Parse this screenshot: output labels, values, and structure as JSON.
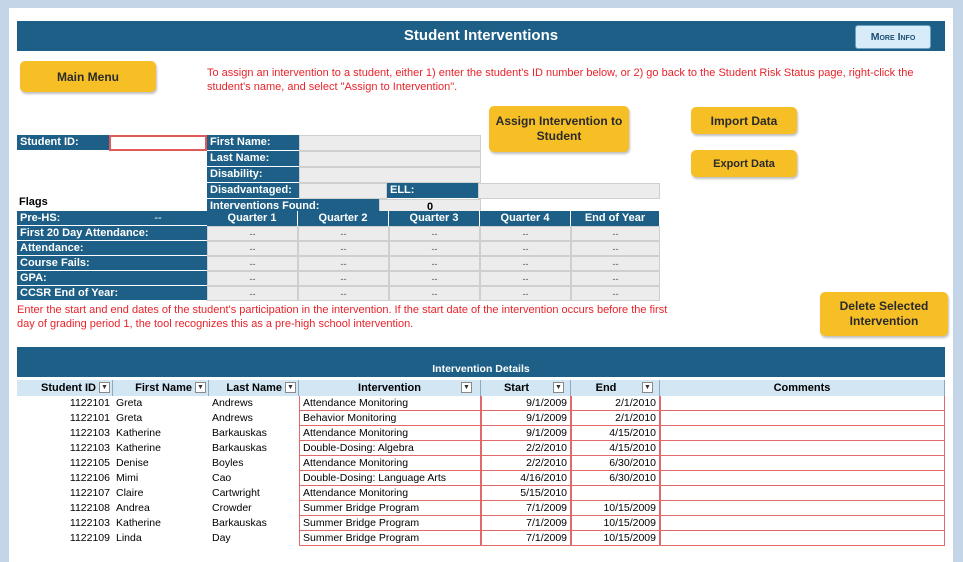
{
  "title": "Student Interventions",
  "more_info_label": "More Info",
  "main_menu_label": "Main Menu",
  "instructions": "To assign an intervention to a student, either 1) enter the student's ID number below, or 2) go back to the Student Risk Status page, right-click the student's name, and select \"Assign to Intervention\".",
  "student_form": {
    "student_id_label": "Student ID:",
    "student_id_value": "",
    "first_name_label": "First Name:",
    "last_name_label": "Last Name:",
    "disability_label": "Disability:",
    "disadvantaged_label": "Disadvantaged:",
    "ell_label": "ELL:",
    "interventions_found_label": "Interventions Found:",
    "interventions_found_value": "0"
  },
  "assign_button_label": "Assign Intervention to Student",
  "import_button_label": "Import Data",
  "export_button_label": "Export Data",
  "delete_button_label": "Delete Selected Intervention",
  "flags": {
    "section_label": "Flags",
    "prehs_label": "Pre-HS:",
    "prehs_value": "--",
    "columns": [
      "Quarter 1",
      "Quarter 2",
      "Quarter 3",
      "Quarter 4",
      "End of Year"
    ],
    "rows": [
      {
        "label": "First 20 Day Attendance:",
        "values": [
          "--",
          "--",
          "--",
          "--",
          "--"
        ]
      },
      {
        "label": "Attendance:",
        "values": [
          "--",
          "--",
          "--",
          "--",
          "--"
        ]
      },
      {
        "label": "Course Fails:",
        "values": [
          "--",
          "--",
          "--",
          "--",
          "--"
        ]
      },
      {
        "label": "GPA:",
        "values": [
          "--",
          "--",
          "--",
          "--",
          "--"
        ]
      },
      {
        "label": "CCSR End of Year:",
        "values": [
          "--",
          "--",
          "--",
          "--",
          "--"
        ]
      }
    ]
  },
  "date_instructions": "Enter the start and end dates of the student's participation in the intervention. If the start date of the intervention occurs before the first day of grading period 1, the tool recognizes this as a pre-high school intervention.",
  "details": {
    "title": "Intervention Details",
    "columns": [
      "Student ID",
      "First Name",
      "Last Name",
      "Intervention",
      "Start",
      "End",
      "Comments"
    ],
    "rows": [
      [
        "1122101",
        "Greta",
        "Andrews",
        "Attendance Monitoring",
        "9/1/2009",
        "2/1/2010",
        ""
      ],
      [
        "1122101",
        "Greta",
        "Andrews",
        "Behavior Monitoring",
        "9/1/2009",
        "2/1/2010",
        ""
      ],
      [
        "1122103",
        "Katherine",
        "Barkauskas",
        "Attendance Monitoring",
        "9/1/2009",
        "4/15/2010",
        ""
      ],
      [
        "1122103",
        "Katherine",
        "Barkauskas",
        "Double-Dosing: Algebra",
        "2/2/2010",
        "4/15/2010",
        ""
      ],
      [
        "1122105",
        "Denise",
        "Boyles",
        "Attendance Monitoring",
        "2/2/2010",
        "6/30/2010",
        ""
      ],
      [
        "1122106",
        "Mimi",
        "Cao",
        "Double-Dosing: Language Arts",
        "4/16/2010",
        "6/30/2010",
        ""
      ],
      [
        "1122107",
        "Claire",
        "Cartwright",
        "Attendance Monitoring",
        "5/15/2010",
        "",
        ""
      ],
      [
        "1122108",
        "Andrea",
        "Crowder",
        "Summer Bridge Program",
        "7/1/2009",
        "10/15/2009",
        ""
      ],
      [
        "1122103",
        "Katherine",
        "Barkauskas",
        "Summer Bridge Program",
        "7/1/2009",
        "10/15/2009",
        ""
      ],
      [
        "1122109",
        "Linda",
        "Day",
        "Summer Bridge Program",
        "7/1/2009",
        "10/15/2009",
        ""
      ]
    ]
  },
  "colors": {
    "header_blue": "#1d5f86",
    "button_yellow": "#f7bf26",
    "instruction_red": "#e8232a"
  }
}
